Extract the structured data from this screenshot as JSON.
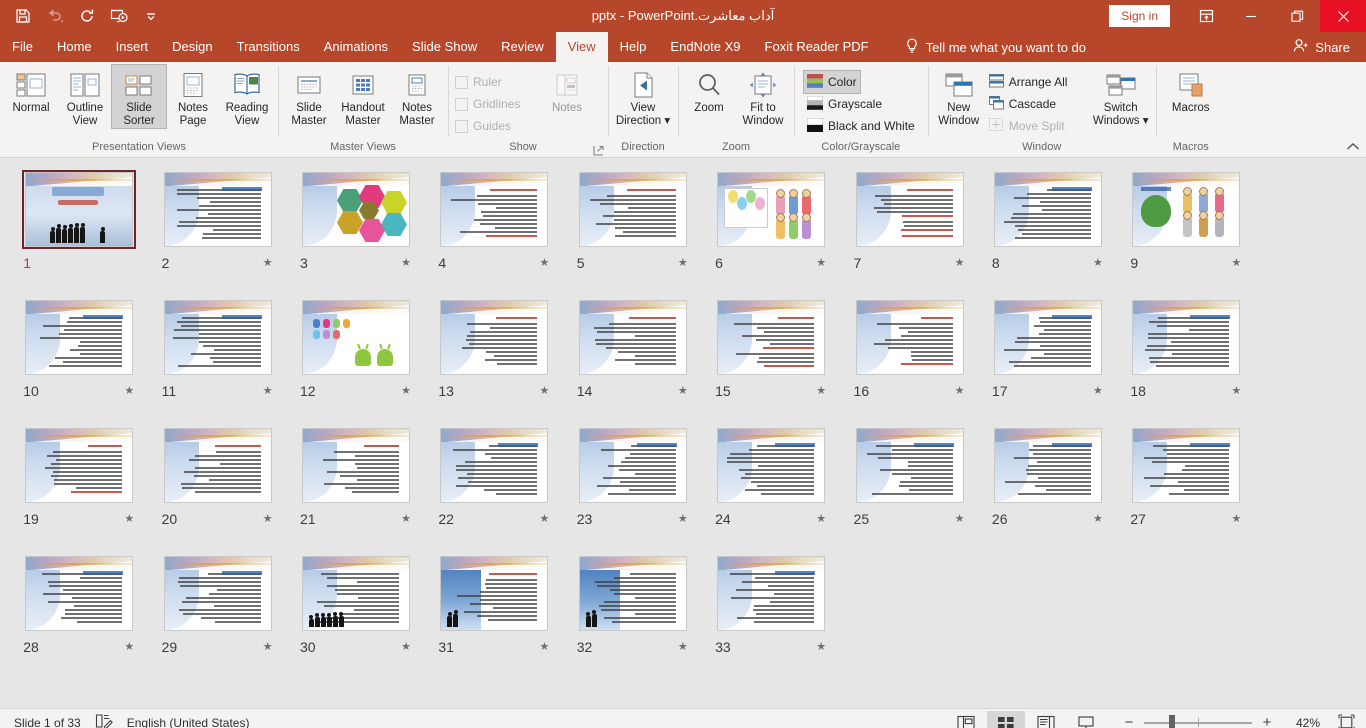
{
  "titlebar": {
    "title": "آداب معاشرت.pptx  -  PowerPoint",
    "quick_access": [
      {
        "name": "save-icon",
        "label": "Save",
        "dim": false
      },
      {
        "name": "undo-icon",
        "label": "Undo",
        "dim": true
      },
      {
        "name": "redo-icon",
        "label": "Redo",
        "dim": false
      },
      {
        "name": "start-from-beginning-icon",
        "label": "Start From Beginning",
        "dim": false
      },
      {
        "name": "customize-quick-access-toolbar-icon",
        "label": "Customize Quick Access Toolbar",
        "dim": false
      }
    ],
    "sign_in": "Sign in",
    "ribbon_display_options": "Ribbon Display Options",
    "minimize": "Minimize",
    "restore": "Restore Down",
    "close": "Close"
  },
  "tabs": [
    {
      "label": "File",
      "active": false
    },
    {
      "label": "Home",
      "active": false
    },
    {
      "label": "Insert",
      "active": false
    },
    {
      "label": "Design",
      "active": false
    },
    {
      "label": "Transitions",
      "active": false
    },
    {
      "label": "Animations",
      "active": false
    },
    {
      "label": "Slide Show",
      "active": false
    },
    {
      "label": "Review",
      "active": false
    },
    {
      "label": "View",
      "active": true
    },
    {
      "label": "Help",
      "active": false
    },
    {
      "label": "EndNote X9",
      "active": false
    },
    {
      "label": "Foxit Reader PDF",
      "active": false
    }
  ],
  "tell_me": "Tell me what you want to do",
  "share": "Share",
  "ribbon": {
    "groups": [
      {
        "label": "Presentation Views",
        "buttons": [
          {
            "name": "normal-view-button",
            "line1": "Normal",
            "line2": "",
            "selected": false
          },
          {
            "name": "outline-view-button",
            "line1": "Outline",
            "line2": "View",
            "selected": false
          },
          {
            "name": "slide-sorter-button",
            "line1": "Slide",
            "line2": "Sorter",
            "selected": true
          },
          {
            "name": "notes-page-button",
            "line1": "Notes",
            "line2": "Page",
            "selected": false
          },
          {
            "name": "reading-view-button",
            "line1": "Reading",
            "line2": "View",
            "selected": false
          }
        ]
      },
      {
        "label": "Master Views",
        "buttons": [
          {
            "name": "slide-master-button",
            "line1": "Slide",
            "line2": "Master",
            "selected": false
          },
          {
            "name": "handout-master-button",
            "line1": "Handout",
            "line2": "Master",
            "selected": false
          },
          {
            "name": "notes-master-button",
            "line1": "Notes",
            "line2": "Master",
            "selected": false
          }
        ]
      },
      {
        "label": "Show",
        "checkboxes": [
          {
            "name": "ruler-checkbox",
            "label": "Ruler",
            "checked": false,
            "disabled": true
          },
          {
            "name": "gridlines-checkbox",
            "label": "Gridlines",
            "checked": false,
            "disabled": true
          },
          {
            "name": "guides-checkbox",
            "label": "Guides",
            "checked": false,
            "disabled": true
          }
        ],
        "buttons": [
          {
            "name": "notes-button",
            "line1": "Notes",
            "line2": "",
            "selected": false,
            "disabled": true
          }
        ],
        "has_dialog_launcher": true
      },
      {
        "label": "Direction",
        "buttons": [
          {
            "name": "view-direction-button",
            "line1": "View",
            "line2": "Direction",
            "dropdown": true,
            "selected": false
          }
        ]
      },
      {
        "label": "Zoom",
        "buttons": [
          {
            "name": "zoom-button",
            "line1": "Zoom",
            "line2": "",
            "selected": false
          },
          {
            "name": "fit-to-window-button",
            "line1": "Fit to",
            "line2": "Window",
            "selected": false
          }
        ]
      },
      {
        "label": "Color/Grayscale",
        "checkboxes": [
          {
            "name": "color-button",
            "label": "Color",
            "selected": true
          },
          {
            "name": "grayscale-button",
            "label": "Grayscale",
            "selected": false
          },
          {
            "name": "black-and-white-button",
            "label": "Black and White",
            "selected": false
          }
        ]
      },
      {
        "label": "Window",
        "buttons": [
          {
            "name": "new-window-button",
            "line1": "New",
            "line2": "Window",
            "selected": false
          }
        ],
        "checkboxes": [
          {
            "name": "arrange-all-button",
            "label": "Arrange All",
            "disabled": false
          },
          {
            "name": "cascade-button",
            "label": "Cascade",
            "disabled": false
          },
          {
            "name": "move-split-button",
            "label": "Move Split",
            "disabled": true
          }
        ],
        "buttons2": [
          {
            "name": "switch-windows-button",
            "line1": "Switch",
            "line2": "Windows",
            "dropdown": true,
            "selected": false
          }
        ]
      },
      {
        "label": "Macros",
        "buttons": [
          {
            "name": "macros-button",
            "line1": "Macros",
            "line2": "",
            "selected": false
          }
        ]
      }
    ],
    "collapse_ribbon": "Collapse the Ribbon"
  },
  "slides": [
    {
      "n": "1",
      "star": false,
      "kind": "title-people",
      "selected": true
    },
    {
      "n": "2",
      "star": true,
      "kind": "text"
    },
    {
      "n": "3",
      "star": true,
      "kind": "hex-smartart"
    },
    {
      "n": "4",
      "star": true,
      "kind": "text-red"
    },
    {
      "n": "5",
      "star": true,
      "kind": "text-red"
    },
    {
      "n": "6",
      "star": true,
      "kind": "kids-balloons"
    },
    {
      "n": "7",
      "star": true,
      "kind": "text-red"
    },
    {
      "n": "8",
      "star": true,
      "kind": "text"
    },
    {
      "n": "9",
      "star": true,
      "kind": "tree-kids"
    },
    {
      "n": "10",
      "star": true,
      "kind": "text"
    },
    {
      "n": "11",
      "star": true,
      "kind": "text"
    },
    {
      "n": "12",
      "star": true,
      "kind": "droids"
    },
    {
      "n": "13",
      "star": true,
      "kind": "text-red"
    },
    {
      "n": "14",
      "star": true,
      "kind": "text-red"
    },
    {
      "n": "15",
      "star": true,
      "kind": "text-red"
    },
    {
      "n": "16",
      "star": true,
      "kind": "text-red"
    },
    {
      "n": "17",
      "star": true,
      "kind": "text"
    },
    {
      "n": "18",
      "star": true,
      "kind": "text"
    },
    {
      "n": "19",
      "star": true,
      "kind": "text-red"
    },
    {
      "n": "20",
      "star": true,
      "kind": "text-red"
    },
    {
      "n": "21",
      "star": true,
      "kind": "text-red"
    },
    {
      "n": "22",
      "star": true,
      "kind": "text"
    },
    {
      "n": "23",
      "star": true,
      "kind": "text"
    },
    {
      "n": "24",
      "star": true,
      "kind": "text"
    },
    {
      "n": "25",
      "star": true,
      "kind": "text"
    },
    {
      "n": "26",
      "star": true,
      "kind": "text"
    },
    {
      "n": "27",
      "star": true,
      "kind": "text"
    },
    {
      "n": "28",
      "star": true,
      "kind": "text"
    },
    {
      "n": "29",
      "star": true,
      "kind": "text"
    },
    {
      "n": "30",
      "star": true,
      "kind": "people-group"
    },
    {
      "n": "31",
      "star": true,
      "kind": "two-people-blue"
    },
    {
      "n": "32",
      "star": true,
      "kind": "two-people-blue2"
    },
    {
      "n": "33",
      "star": true,
      "kind": "text"
    }
  ],
  "statusbar": {
    "slide_counter": "Slide 1 of 33",
    "spellcheck_icon": "spell-check-icon",
    "language": "English (United States)",
    "views": [
      {
        "name": "view-normal-button",
        "label": "Normal",
        "active": false
      },
      {
        "name": "view-slide-sorter-button",
        "label": "Slide Sorter",
        "active": true
      },
      {
        "name": "view-reading-button",
        "label": "Reading View",
        "active": false
      },
      {
        "name": "view-slide-show-button",
        "label": "Slide Show",
        "active": false
      }
    ],
    "zoom_out": "−",
    "zoom_in": "+",
    "zoom_level": "42%",
    "fit_to_window": "Fit slide to current window"
  },
  "colors": {
    "brand": "#b7472a",
    "close": "#e81123",
    "selected_slide_border": "#70252a",
    "selected_slide_number": "#c0392b",
    "ribbon_bg": "#f4f3f2",
    "sorter_bg": "#e6e6e6"
  }
}
